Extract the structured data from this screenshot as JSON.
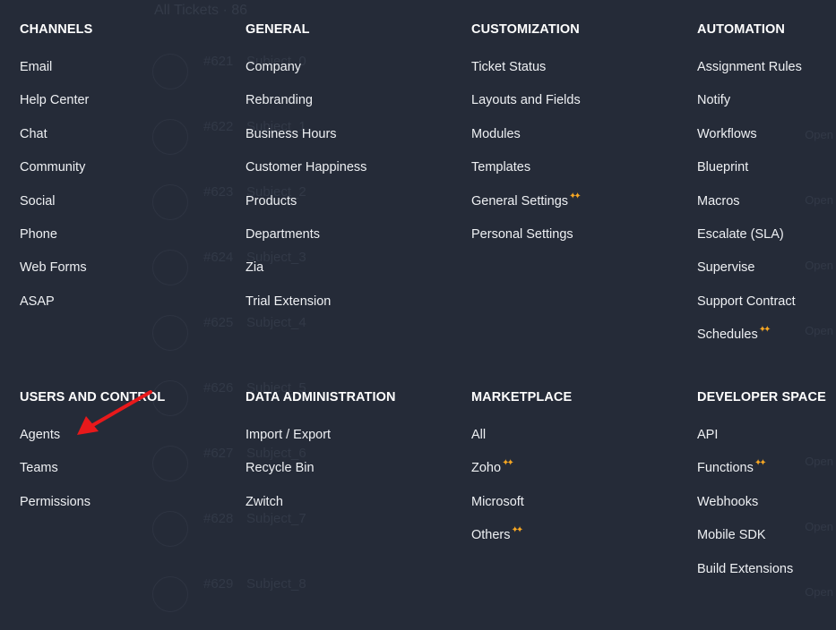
{
  "background": {
    "header": "All Tickets · 86",
    "tickets": [
      {
        "num": "#621",
        "subject": "Subject_0",
        "status": ""
      },
      {
        "num": "#622",
        "subject": "Subject_1",
        "status": "Open"
      },
      {
        "num": "#623",
        "subject": "Subject_2",
        "status": "Open"
      },
      {
        "num": "#624",
        "subject": "Subject_3",
        "status": "Open"
      },
      {
        "num": "#625",
        "subject": "Subject_4",
        "status": "Open"
      },
      {
        "num": "#626",
        "subject": "Subject_5",
        "status": ""
      },
      {
        "num": "#627",
        "subject": "Subject_6",
        "status": "Open"
      },
      {
        "num": "#628",
        "subject": "Subject_7",
        "status": "Open"
      },
      {
        "num": "#629",
        "subject": "Subject_8",
        "status": "Open"
      }
    ]
  },
  "sections": [
    {
      "title": "CHANNELS",
      "items": [
        {
          "label": "Email"
        },
        {
          "label": "Help Center"
        },
        {
          "label": "Chat"
        },
        {
          "label": "Community"
        },
        {
          "label": "Social"
        },
        {
          "label": "Phone"
        },
        {
          "label": "Web Forms"
        },
        {
          "label": "ASAP"
        }
      ]
    },
    {
      "title": "GENERAL",
      "items": [
        {
          "label": "Company"
        },
        {
          "label": "Rebranding"
        },
        {
          "label": "Business Hours"
        },
        {
          "label": "Customer Happiness"
        },
        {
          "label": "Products"
        },
        {
          "label": "Departments"
        },
        {
          "label": "Zia"
        },
        {
          "label": "Trial Extension"
        }
      ]
    },
    {
      "title": "CUSTOMIZATION",
      "items": [
        {
          "label": "Ticket Status"
        },
        {
          "label": "Layouts and Fields"
        },
        {
          "label": "Modules"
        },
        {
          "label": "Templates"
        },
        {
          "label": "General Settings",
          "new": true
        },
        {
          "label": "Personal Settings"
        }
      ]
    },
    {
      "title": "AUTOMATION",
      "items": [
        {
          "label": "Assignment Rules"
        },
        {
          "label": "Notify"
        },
        {
          "label": "Workflows"
        },
        {
          "label": "Blueprint"
        },
        {
          "label": "Macros"
        },
        {
          "label": "Escalate (SLA)"
        },
        {
          "label": "Supervise"
        },
        {
          "label": "Support Contract"
        },
        {
          "label": "Schedules",
          "new": true
        }
      ]
    },
    {
      "title": "USERS AND CONTROL",
      "items": [
        {
          "label": "Agents"
        },
        {
          "label": "Teams"
        },
        {
          "label": "Permissions"
        }
      ]
    },
    {
      "title": "DATA ADMINISTRATION",
      "items": [
        {
          "label": "Import / Export"
        },
        {
          "label": "Recycle Bin"
        },
        {
          "label": "Zwitch"
        }
      ]
    },
    {
      "title": "MARKETPLACE",
      "items": [
        {
          "label": "All"
        },
        {
          "label": "Zoho",
          "new": true
        },
        {
          "label": "Microsoft"
        },
        {
          "label": "Others",
          "new": true
        }
      ]
    },
    {
      "title": "DEVELOPER SPACE",
      "items": [
        {
          "label": "API"
        },
        {
          "label": "Functions",
          "new": true
        },
        {
          "label": "Webhooks"
        },
        {
          "label": "Mobile SDK"
        },
        {
          "label": "Build Extensions"
        }
      ]
    }
  ],
  "colors": {
    "background": "#252b38",
    "sparkle": "#f5a623",
    "annotation_arrow": "#e8191b"
  },
  "icons": {
    "new_badge": "sparkle-icon",
    "annotation": "red-arrow-icon"
  }
}
